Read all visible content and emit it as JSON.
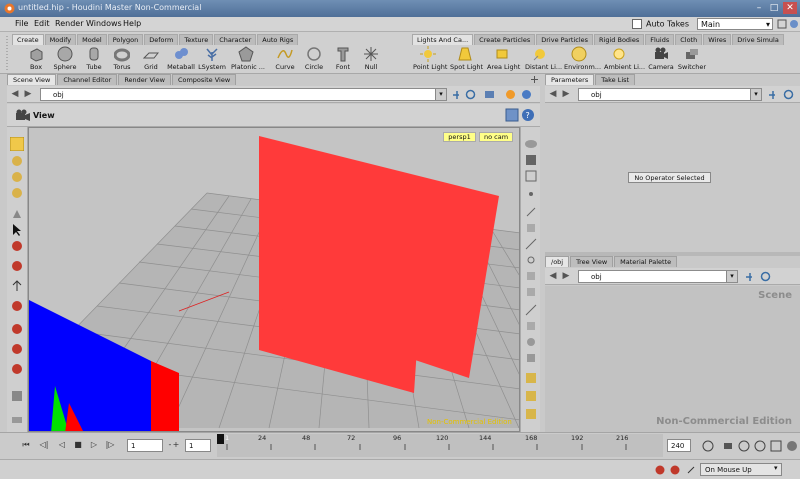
{
  "window": {
    "title": "untitled.hip - Houdini Master Non-Commercial"
  },
  "menu": [
    "File",
    "Edit",
    "Render",
    "Windows",
    "Help"
  ],
  "auto_takes": {
    "label": "Auto Takes",
    "checked": false
  },
  "desktop": {
    "selected": "Main"
  },
  "shelf_left": {
    "tabs": [
      "Create",
      "Modify",
      "Model",
      "Polygon",
      "Deform",
      "Texture",
      "Character",
      "Auto Rigs"
    ],
    "active_tab": "Create",
    "tools": [
      "Box",
      "Sphere",
      "Tube",
      "Torus",
      "Grid",
      "Metaball",
      "LSystem",
      "Platonic ...",
      "Curve",
      "Circle",
      "Font",
      "Null"
    ]
  },
  "shelf_right": {
    "tabs": [
      "Lights And Ca...",
      "Create Particles",
      "Drive Particles",
      "Rigid Bodies",
      "Fluids",
      "Cloth",
      "Wires",
      "Drive Simula"
    ],
    "active_tab": "Lights And Ca...",
    "tools": [
      "Point Light",
      "Spot Light",
      "Area Light",
      "Distant Li...",
      "Environm...",
      "Ambient Li...",
      "Camera",
      "Switcher"
    ]
  },
  "left_pane": {
    "tabs": [
      "Scene View",
      "Channel Editor",
      "Render View",
      "Composite View"
    ],
    "active_tab": "Scene View",
    "path": "obj",
    "view_label": "View",
    "viewport_menus": [
      "persp1",
      "no cam"
    ],
    "watermark": "Non-Commercial Edition"
  },
  "params_pane": {
    "tabs": [
      "Parameters",
      "Take List"
    ],
    "active_tab": "Parameters",
    "path": "obj",
    "message": "No Operator Selected"
  },
  "network_pane": {
    "tabs": [
      "/obj",
      "Tree View",
      "Material Palette"
    ],
    "active_tab": "/obj",
    "path": "obj",
    "context_label": "Scene",
    "watermark": "Non-Commercial Edition"
  },
  "timeline": {
    "current_frame": "1",
    "start_frame": "1",
    "end_frame": "240",
    "ticks": [
      "1",
      "24",
      "48",
      "72",
      "96",
      "120",
      "144",
      "168",
      "192",
      "216"
    ]
  },
  "status": {
    "update_mode": "On Mouse Up"
  },
  "colors": {
    "red_plane": "#ff3a3a",
    "blue_box": "#0000ff",
    "red_box": "#ff0000",
    "green": "#00e000",
    "background": "#c4c4c4"
  }
}
